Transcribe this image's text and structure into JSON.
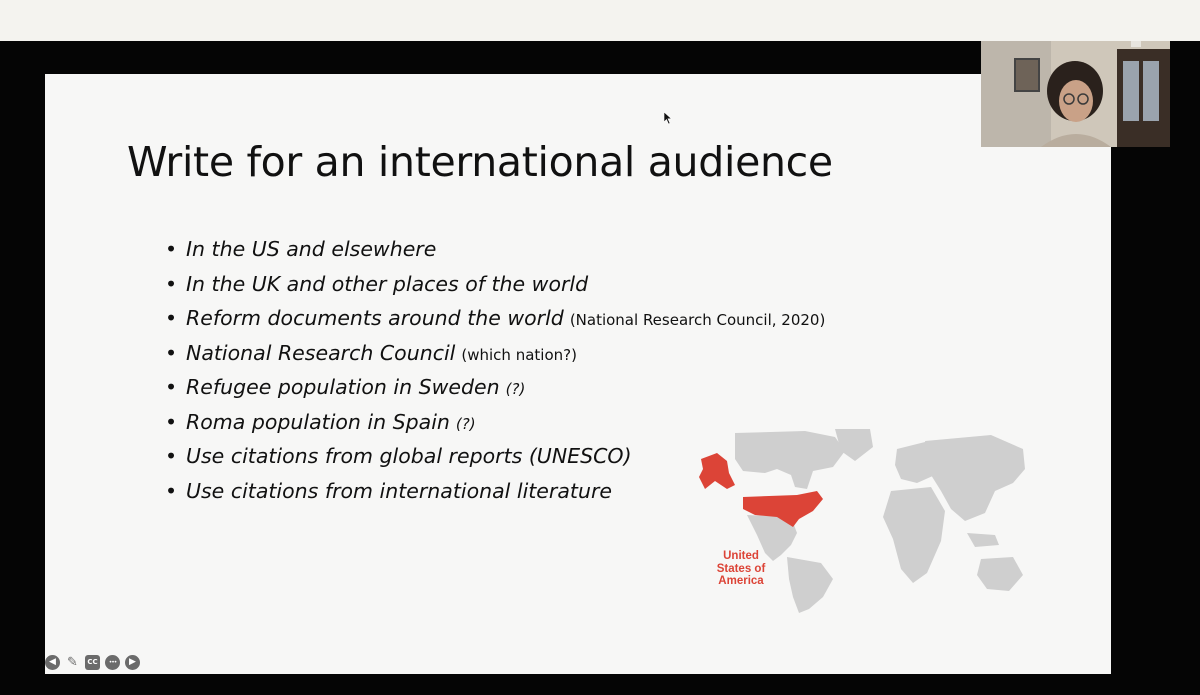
{
  "slide": {
    "title": "Write for an international audience",
    "bullet_glyph": "•",
    "bullets": [
      {
        "main": "In the US and elsewhere",
        "note": ""
      },
      {
        "main": "In the UK and other places of the world",
        "note": ""
      },
      {
        "main": "Reform documents around the world",
        "note": "(National Research Council, 2020)"
      },
      {
        "main": "National Research Council",
        "note": "(which nation?)"
      },
      {
        "main": "Refugee population in Sweden",
        "note": "(?)"
      },
      {
        "main": "Roma population in Spain",
        "note": "(?)"
      },
      {
        "main": "Use citations from global reports (UNESCO)",
        "note": ""
      },
      {
        "main": "Use citations from international literature",
        "note": ""
      }
    ],
    "map_label_lines": [
      "United",
      "States of",
      "America"
    ],
    "map_colors": {
      "land": "#cfcfcf",
      "highlight": "#dc4437"
    }
  },
  "controls": [
    {
      "icon": "arrow-left-icon",
      "glyph": "◀"
    },
    {
      "icon": "pencil-icon",
      "glyph": "✎"
    },
    {
      "icon": "closed-captions-icon",
      "glyph": "CC"
    },
    {
      "icon": "more-icon",
      "glyph": "•••"
    },
    {
      "icon": "arrow-right-icon",
      "glyph": "▶"
    }
  ]
}
